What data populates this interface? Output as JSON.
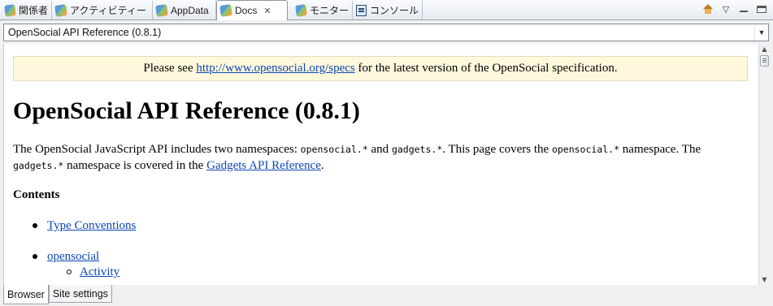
{
  "tabs": [
    {
      "label": "関係者",
      "icon": "perspective-view-icon",
      "active": false
    },
    {
      "label": "アクティビティー",
      "icon": "perspective-view-icon",
      "active": false
    },
    {
      "label": "AppData",
      "icon": "perspective-view-icon",
      "active": false
    },
    {
      "label": "Docs",
      "icon": "perspective-view-icon",
      "active": true,
      "close": "✕"
    },
    {
      "label": "モニター",
      "icon": "perspective-view-icon",
      "active": false
    },
    {
      "label": "コンソール",
      "icon": "console-icon",
      "active": false
    }
  ],
  "address": {
    "value": "OpenSocial API Reference (0.8.1)"
  },
  "page": {
    "notice_prefix": "Please see ",
    "notice_link": "http://www.opensocial.org/specs",
    "notice_suffix": " for the latest version of the OpenSocial specification.",
    "title": "OpenSocial API Reference (0.8.1)",
    "intro": {
      "t1": "The OpenSocial JavaScript API includes two namespaces: ",
      "c1": "opensocial.*",
      "t2": " and ",
      "c2": "gadgets.*",
      "t3": ". This page covers the ",
      "c3": "opensocial.*",
      "t4": " namespace. The ",
      "c4": "gadgets.*",
      "t5": " namespace is covered in the ",
      "link": "Gadgets API Reference",
      "t6": "."
    },
    "contents_heading": "Contents",
    "contents_items": [
      {
        "label": "Type Conventions"
      },
      {
        "label": "opensocial",
        "children": [
          {
            "label": "Activity"
          }
        ]
      }
    ]
  },
  "bottom_tabs": [
    {
      "label": "Browser",
      "active": true
    },
    {
      "label": "Site settings",
      "active": false
    }
  ],
  "colors": {
    "link": "#0b46b6",
    "notice_bg": "#fff8dd"
  }
}
